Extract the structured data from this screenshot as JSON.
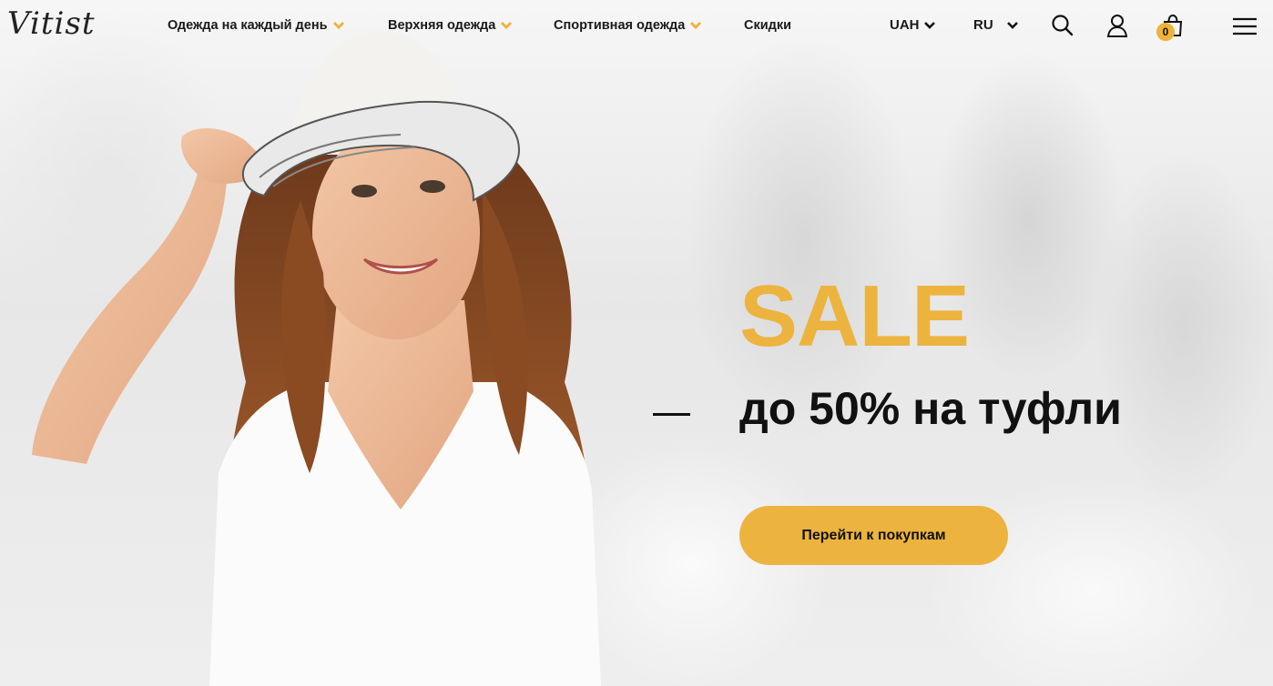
{
  "brand": {
    "logo_text": "Vitist"
  },
  "nav": {
    "items": [
      {
        "label": "Одежда на каждый день",
        "has_dropdown": true
      },
      {
        "label": "Верхняя одежда",
        "has_dropdown": true
      },
      {
        "label": "Спортивная одежда",
        "has_dropdown": true
      },
      {
        "label": "Скидки",
        "has_dropdown": false
      }
    ]
  },
  "header": {
    "currency": "UAH",
    "language": "RU",
    "cart_count": "0",
    "icons": [
      "search-icon",
      "user-icon",
      "cart-icon",
      "menu-icon"
    ]
  },
  "promo": {
    "title": "SALE",
    "subtitle": "до 50% на туфли",
    "cta_label": "Перейти к покупкам"
  },
  "colors": {
    "accent": "#ecb33e",
    "text": "#111111",
    "background": "#ececec"
  }
}
